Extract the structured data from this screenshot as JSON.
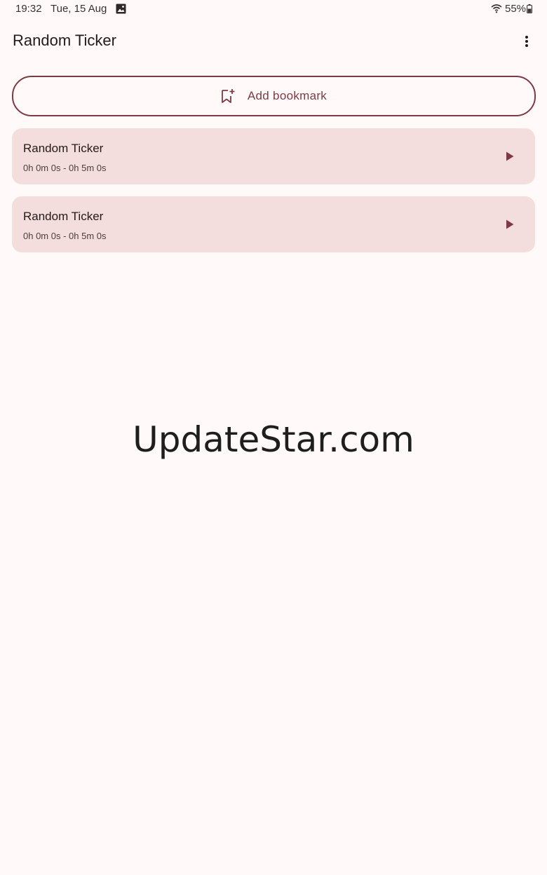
{
  "status_bar": {
    "time": "19:32",
    "date": "Tue, 15 Aug",
    "battery": "55%",
    "icons": [
      "gallery-icon",
      "wifi-icon",
      "battery-icon"
    ]
  },
  "app_bar": {
    "title": "Random Ticker",
    "menu_icon": "more-vert-icon"
  },
  "add_bookmark": {
    "label": "Add bookmark",
    "icon": "bookmark-add-icon"
  },
  "tickers": [
    {
      "name": "Random Ticker",
      "range": "0h 0m 0s - 0h 5m 0s",
      "action_icon": "play-icon"
    },
    {
      "name": "Random Ticker",
      "range": "0h 0m 0s - 0h 5m 0s",
      "action_icon": "play-icon"
    }
  ],
  "watermark": "UpdateStar.com",
  "colors": {
    "background": "#fffaf9",
    "accent": "#7d3a44",
    "card": "#f3dedd",
    "text": "#231a1a"
  }
}
